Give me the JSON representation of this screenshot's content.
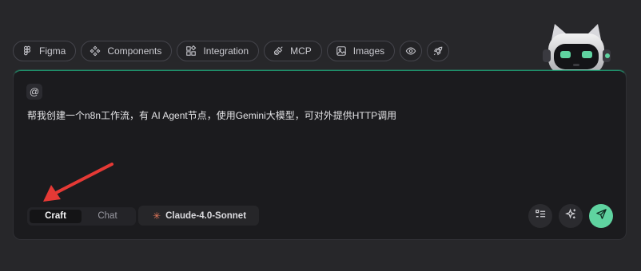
{
  "toolbar": {
    "chips": [
      {
        "label": "Figma",
        "icon": "figma-icon"
      },
      {
        "label": "Components",
        "icon": "components-icon"
      },
      {
        "label": "Integration",
        "icon": "integration-icon"
      },
      {
        "label": "MCP",
        "icon": "plug-icon"
      },
      {
        "label": "Images",
        "icon": "image-icon"
      }
    ],
    "round_buttons": [
      {
        "icon": "eye-icon"
      },
      {
        "icon": "rocket-icon"
      }
    ]
  },
  "composer": {
    "mention_symbol": "@",
    "prompt_text": "帮我创建一个n8n工作流，有 AI Agent节点，使用Gemini大模型，可对外提供HTTP调用",
    "modes": [
      "Craft",
      "Chat"
    ],
    "active_mode": "Craft",
    "model_name": "Claude-4.0-Sonnet",
    "model_icon": "sparkle-icon",
    "right_buttons": [
      "checklist-icon",
      "magic-sparkle-icon",
      "send-icon"
    ]
  },
  "annotation": {
    "type": "red-arrow",
    "target": "mode-toggle"
  },
  "colors": {
    "background": "#27272a",
    "card": "#1b1b1e",
    "accent_green": "#5fd3a0",
    "model_spark": "#e2775a",
    "annotation_red": "#e53935"
  }
}
